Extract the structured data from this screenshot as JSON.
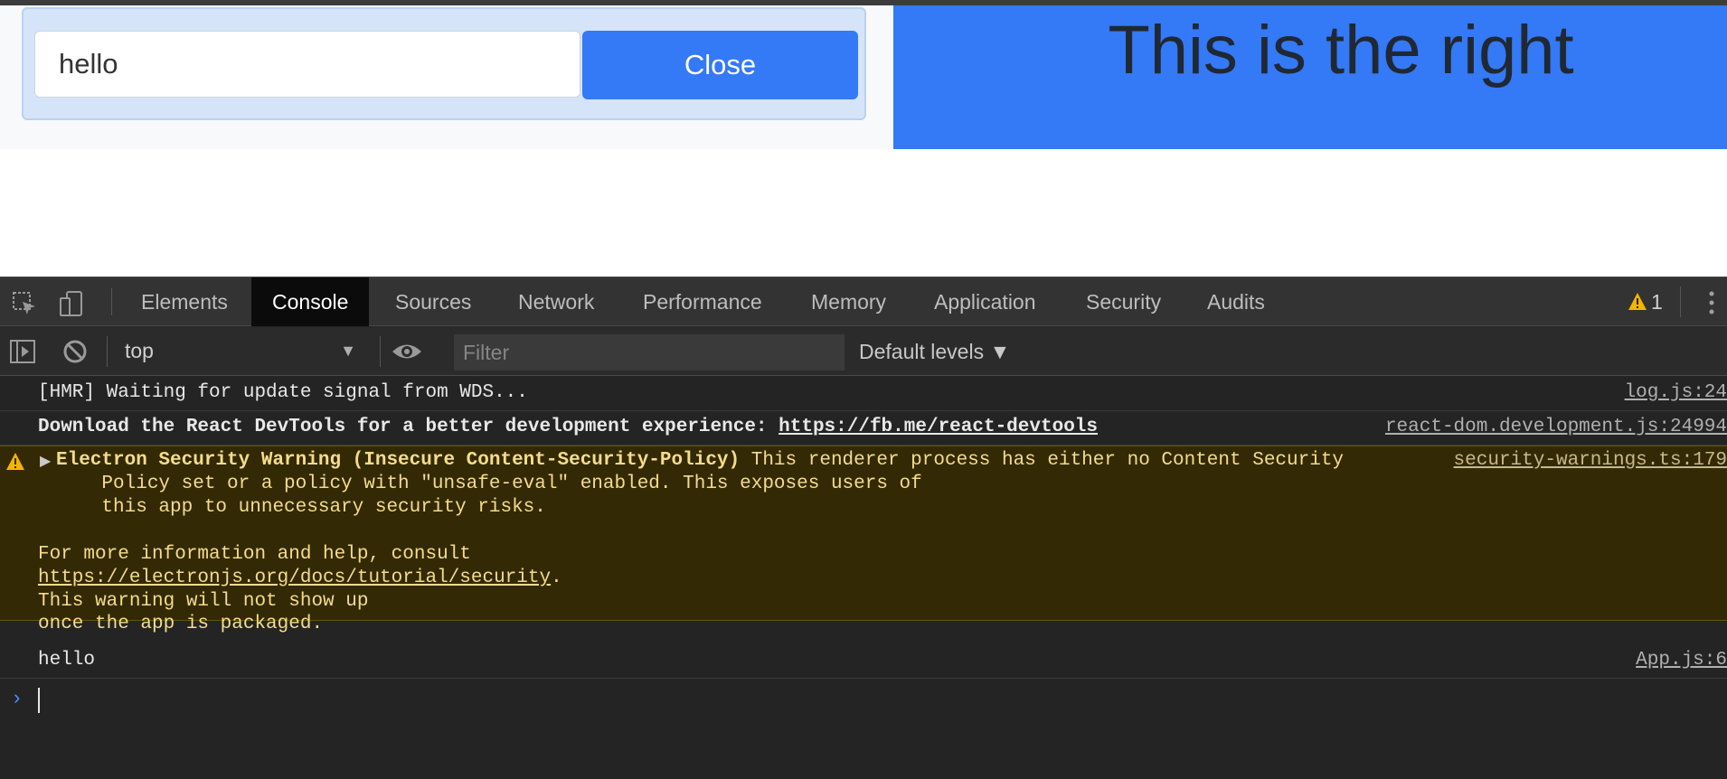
{
  "app": {
    "input_value": "hello",
    "close_label": "Close",
    "right_title": "This is the right"
  },
  "devtools": {
    "tabs": [
      "Elements",
      "Console",
      "Sources",
      "Network",
      "Performance",
      "Memory",
      "Application",
      "Security",
      "Audits"
    ],
    "active_tab": "Console",
    "warning_count": "1",
    "context": "top",
    "filter_placeholder": "Filter",
    "levels_label": "Default levels ▼"
  },
  "console": {
    "messages": [
      {
        "text": "[HMR] Waiting for update signal from WDS...",
        "source": "log.js:24"
      },
      {
        "text_prefix": "Download the React DevTools for a better development experience: ",
        "link": "https://fb.me/react-devtools",
        "source": "react-dom.development.js:24994"
      },
      {
        "title": "Electron Security Warning (Insecure Content-Security-Policy)",
        "line1": " This renderer process has either no Content Security",
        "line2": "    Policy set or a policy with \"unsafe-eval\" enabled. This exposes users of",
        "line3": "    this app to unnecessary security risks.",
        "line4": "For more information and help, consult",
        "link": "https://electronjs.org/docs/tutorial/security",
        "link_suffix": ".",
        "line5": "This warning will not show up",
        "line6": "once the app is packaged.",
        "source": "security-warnings.ts:179"
      },
      {
        "text": "hello",
        "source": "App.js:6"
      }
    ],
    "prompt": "›"
  },
  "icons": {
    "inspect": "inspect-element-icon",
    "device": "device-toolbar-icon",
    "warning": "warning-triangle-icon",
    "more": "more-vertical-icon",
    "sidebar": "show-sidebar-icon",
    "clear": "clear-console-icon",
    "eye": "live-expression-eye-icon",
    "expand": "expand-triangle-icon"
  }
}
